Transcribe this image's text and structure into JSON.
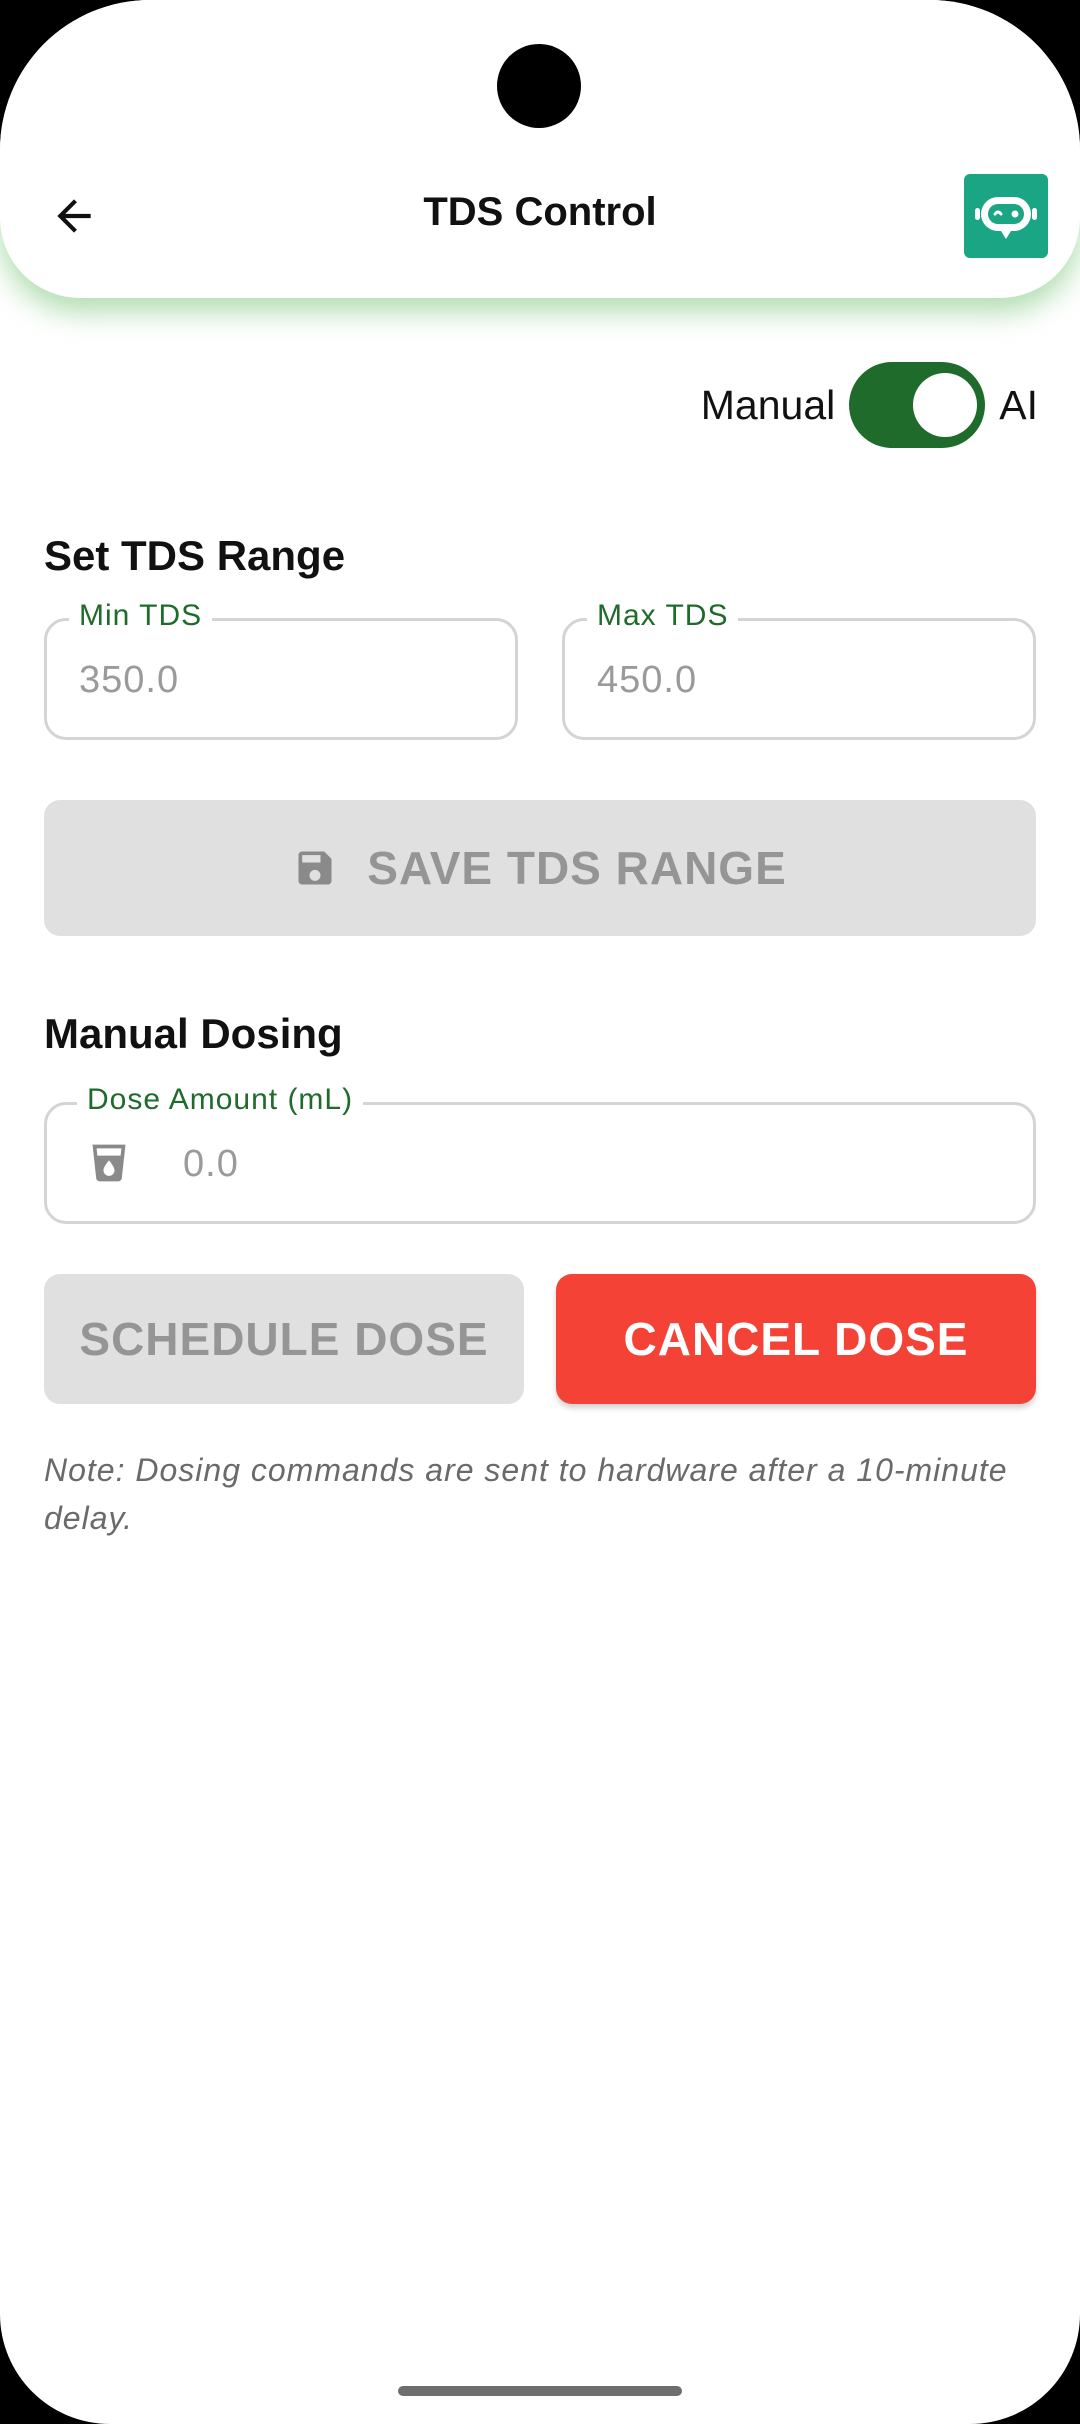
{
  "app_bar": {
    "title": "TDS Control",
    "back_icon": "arrow-left-icon",
    "assistant_icon": "robot-icon",
    "assistant_color": "#1aa585",
    "shadow_color": "#52b452"
  },
  "mode_toggle": {
    "left_label": "Manual",
    "right_label": "AI",
    "state": "on",
    "track_color": "#1e6b2b"
  },
  "tds_range": {
    "section_title": "Set TDS Range",
    "min": {
      "label": "Min TDS",
      "placeholder": "350.0",
      "value": ""
    },
    "max": {
      "label": "Max TDS",
      "placeholder": "450.0",
      "value": ""
    },
    "save_button": {
      "label": "SAVE TDS RANGE",
      "icon": "save-icon",
      "enabled": false
    }
  },
  "manual_dosing": {
    "section_title": "Manual Dosing",
    "dose": {
      "label": "Dose Amount (mL)",
      "placeholder": "0.0",
      "value": "",
      "icon": "cup-icon"
    },
    "schedule_button": {
      "label": "SCHEDULE DOSE",
      "enabled": false
    },
    "cancel_button": {
      "label": "CANCEL DOSE",
      "enabled": true,
      "color": "#f44336"
    },
    "note": "Note: Dosing commands are sent to hardware after a 10-minute delay."
  },
  "colors": {
    "accent": "#1e6b2b",
    "disabled_bg": "#e0e0e0",
    "disabled_text": "#959595"
  }
}
